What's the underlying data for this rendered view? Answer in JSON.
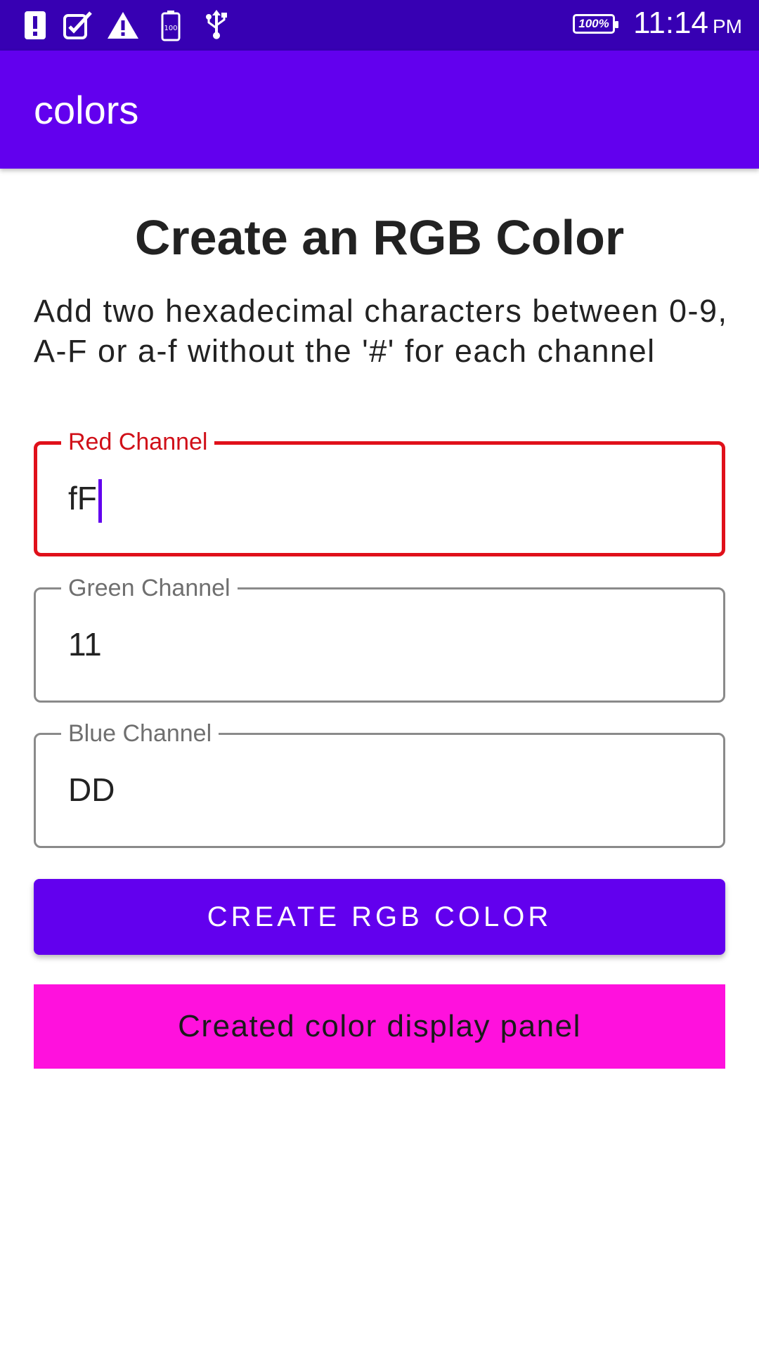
{
  "status_bar": {
    "icons": [
      "alert-notification-icon",
      "checklist-icon",
      "warning-icon",
      "battery-100-small-icon",
      "usb-icon"
    ],
    "battery_text": "100%",
    "time": "11:14",
    "ampm": "PM"
  },
  "app_bar": {
    "title": "colors"
  },
  "main": {
    "heading": "Create an RGB Color",
    "instructions": "Add two hexadecimal characters between 0-9, A-F or a-f without the '#' for each channel",
    "fields": [
      {
        "label": "Red Channel",
        "value": "fF",
        "focused": true
      },
      {
        "label": "Green Channel",
        "value": "11",
        "focused": false
      },
      {
        "label": "Blue Channel",
        "value": "DD",
        "focused": false
      }
    ],
    "create_button": "CREATE RGB COLOR",
    "panel_text": "Created color display panel"
  },
  "colors": {
    "status_bar": "#3700B3",
    "app_bar": "#6200EE",
    "accent": "#6200EE",
    "error": "#E0101A",
    "panel": "#FF11DD"
  }
}
